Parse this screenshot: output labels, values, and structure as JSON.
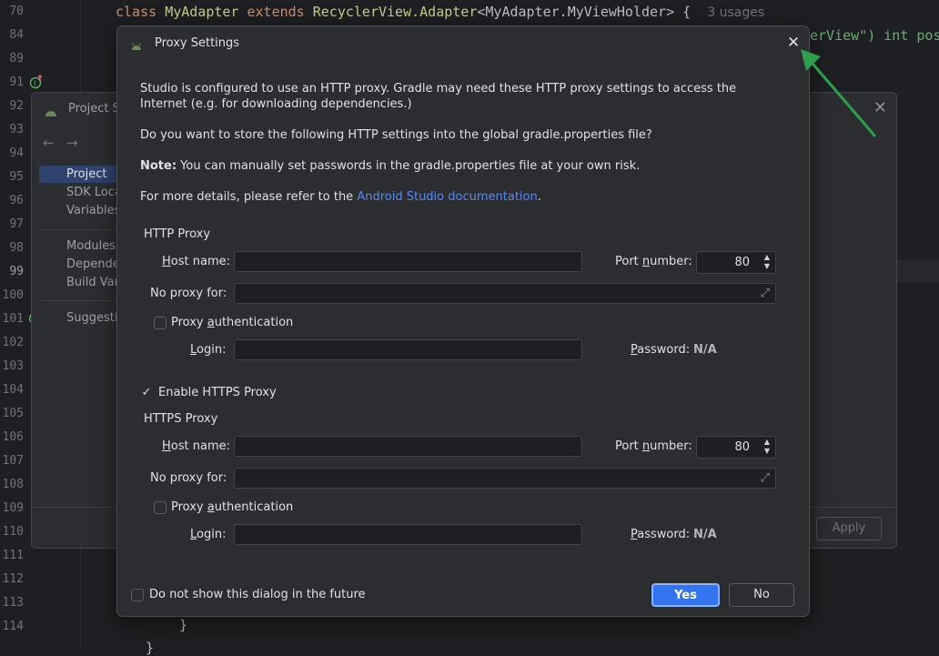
{
  "editor": {
    "line_numbers": [
      "70",
      "84",
      "89",
      "91",
      "92",
      "93",
      "94",
      "95",
      "96",
      "97",
      "98",
      "99",
      "100",
      "101",
      "102",
      "103",
      "104",
      "105",
      "106",
      "107",
      "108",
      "109",
      "110",
      "111",
      "112",
      "113",
      "114"
    ],
    "current_line": "99",
    "code_line_70": {
      "kw_class": "class",
      "name": "MyAdapter",
      "kw_extends": "extends",
      "parent": "RecyclerView.Adapter",
      "generic": "<MyAdapter.MyViewHolder>",
      "brace": "{",
      "usages": "3 usages"
    },
    "code_line_84": {
      "text": "erView\") int posi"
    },
    "code_line_114": {
      "text": "}"
    },
    "code_line_115": {
      "text": "}"
    }
  },
  "project_structure": {
    "title": "Project St",
    "nav": [
      "Project",
      "SDK Locat",
      "Variables"
    ],
    "modules": [
      "Modules",
      "Depender",
      "Build Vari"
    ],
    "suggestions": "Suggestio",
    "apply_label": "Apply"
  },
  "proxy_dialog": {
    "title": "Proxy Settings",
    "intro": "Studio is configured to use an HTTP proxy. Gradle may need these HTTP proxy settings to access the Internet (e.g. for downloading dependencies.)",
    "question": "Do you want to store the following HTTP settings into the global gradle.properties file?",
    "note_label": "Note:",
    "note_text": " You can manually set passwords in the gradle.properties file at your own risk.",
    "details_prefix": "For more details, please refer to the ",
    "details_link": "Android Studio documentation",
    "details_suffix": ".",
    "http": {
      "section": "HTTP Proxy",
      "host_label_u": "H",
      "host_label_rest": "ost name:",
      "host_value": "",
      "port_label_a": "Port ",
      "port_label_u": "n",
      "port_label_b": "umber:",
      "port_value": "80",
      "no_proxy_label": "No proxy for:",
      "no_proxy_value": "",
      "auth_label_a": "Proxy ",
      "auth_label_u": "a",
      "auth_label_b": "uthentication",
      "auth_checked": false,
      "login_label_u": "L",
      "login_label_rest": "ogin:",
      "login_value": "",
      "password_label_u": "P",
      "password_label_rest": "assword:",
      "password_value": "N/A"
    },
    "enable_https_label": "Enable HTTPS Proxy",
    "enable_https_checked": true,
    "https": {
      "section": "HTTPS Proxy",
      "host_label_u": "H",
      "host_label_rest": "ost name:",
      "host_value": "",
      "port_label_a": "Port ",
      "port_label_u": "n",
      "port_label_b": "umber:",
      "port_value": "80",
      "no_proxy_label": "No proxy for:",
      "no_proxy_value": "",
      "auth_label_a": "Proxy ",
      "auth_label_u": "a",
      "auth_label_b": "uthentication",
      "auth_checked": false,
      "login_label_u": "L",
      "login_label_rest": "ogin:",
      "login_value": "",
      "password_label_u": "P",
      "password_label_rest": "assword:",
      "password_value": "N/A"
    },
    "dont_show_label": "Do not show this dialog in the future",
    "yes_label": "Yes",
    "no_label": "No"
  },
  "colors": {
    "accent": "#3574f0",
    "link": "#548af7",
    "annotation_arrow": "#2e9e4a"
  }
}
